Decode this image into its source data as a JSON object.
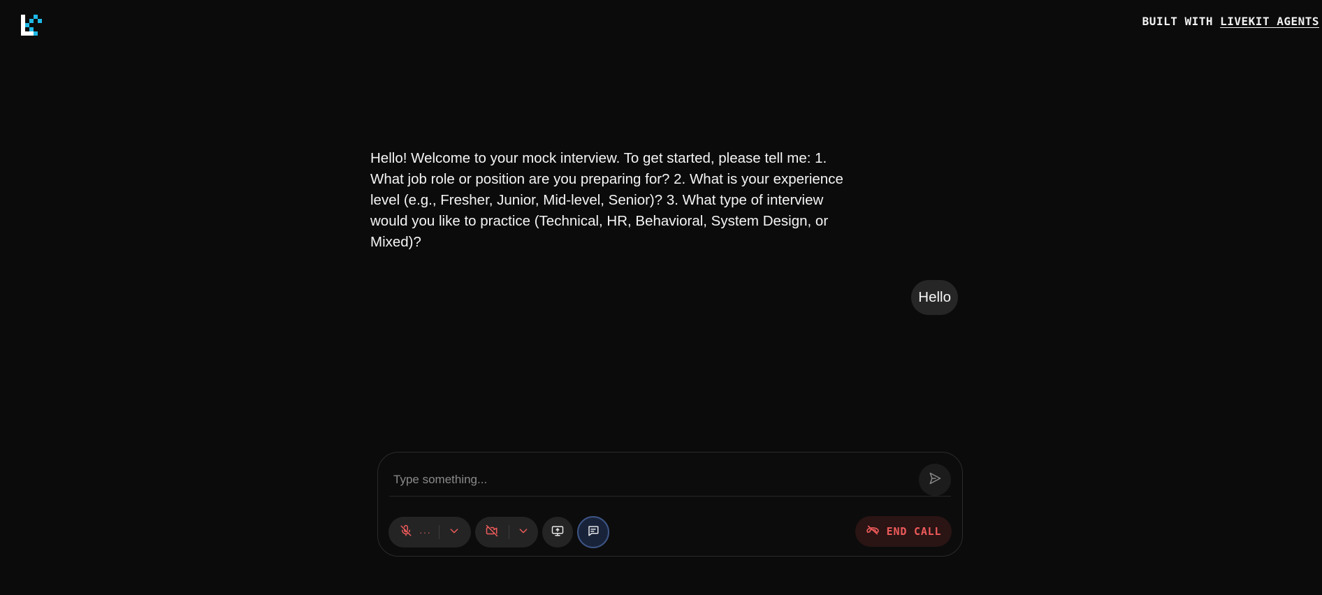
{
  "header": {
    "logo_icon": "livekit-logo-icon",
    "credit_prefix": "BUILT WITH",
    "credit_link": "LIVEKIT AGENTS"
  },
  "transcript": {
    "agent_message": "Hello! Welcome to your mock interview. To get started, please tell me: 1. What job role or position are you preparing for? 2. What is your experience level (e.g., Fresher, Junior, Mid-level, Senior)? 3. What type of interview would you like to practice (Technical, HR, Behavioral, System Design, or Mixed)?",
    "user_message": "Hello"
  },
  "control_bar": {
    "chat_input_placeholder": "Type something...",
    "send_icon": "send-icon",
    "mic": {
      "icon": "mic-off-icon",
      "level_indicator": "···",
      "menu_icon": "chevron-down-icon"
    },
    "camera": {
      "icon": "camera-off-icon",
      "menu_icon": "chevron-down-icon"
    },
    "screen_share_icon": "screen-share-icon",
    "chat_toggle_icon": "chat-icon",
    "end_call_label": "END CALL",
    "end_call_icon": "phone-hangup-icon"
  },
  "colors": {
    "background": "#0b0b0b",
    "danger": "#ef5b5b",
    "danger_bg": "#2a1414",
    "accent_cyan": "#1fb8e6",
    "chat_toggle_active": "#3d5586"
  }
}
